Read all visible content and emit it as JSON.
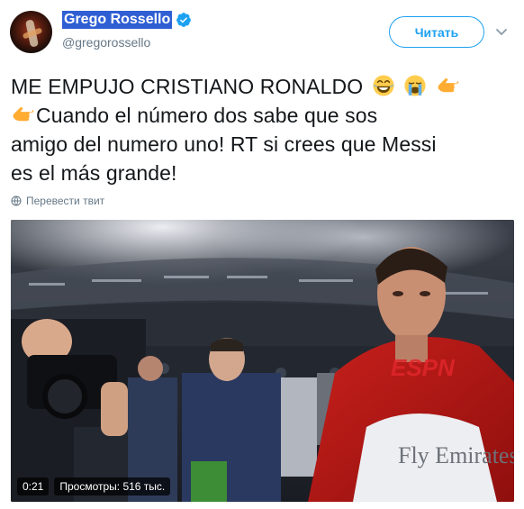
{
  "user": {
    "display_name": "Grego Rossello",
    "handle": "@gregorossello",
    "verified": true
  },
  "header": {
    "follow_label": "Читать"
  },
  "tweet": {
    "line1": "ME EMPUJO CRISTIANO RONALDO",
    "line2": "Cuando el número dos sabe que sos",
    "line3": "amigo del numero uno! RT si crees que Messi",
    "line4": "es el más grande!"
  },
  "translate": {
    "label": "Перевести твит"
  },
  "video": {
    "duration": "0:21",
    "views": "Просмотры: 516 тыс.",
    "logo_text": "ESPN",
    "shirt_text": "Fly Emirates"
  },
  "icons": {
    "verified": "verified-badge-icon",
    "caret": "chevron-down-icon",
    "globe": "globe-icon",
    "emoji": [
      "tears-of-joy-emoji",
      "crying-emoji",
      "pointing-left-emoji",
      "pointing-left-emoji"
    ]
  },
  "colors": {
    "accent": "#1da1f2",
    "name_highlight": "#2f5fd3",
    "muted": "#657786",
    "text": "#14171a"
  }
}
